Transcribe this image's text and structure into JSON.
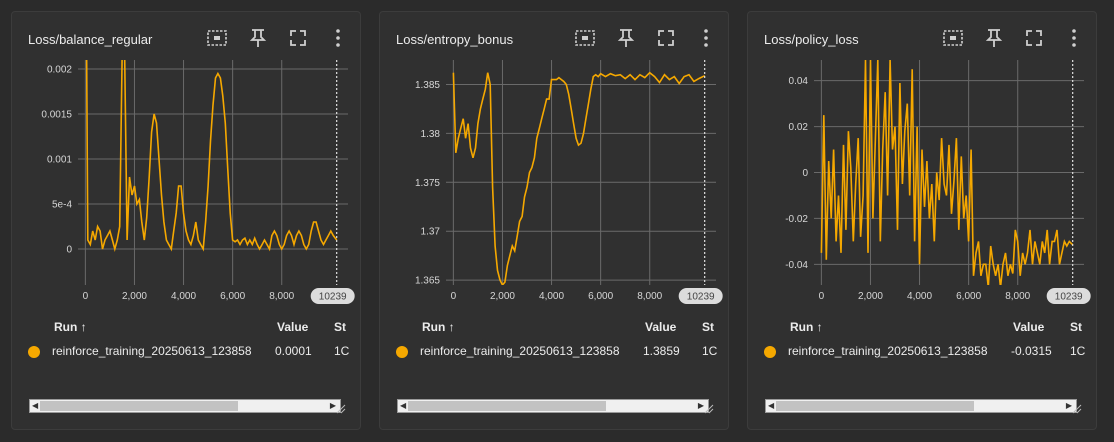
{
  "accent_color": "#f5a800",
  "toolbar_icons": [
    "fit-domain-icon",
    "pin-icon",
    "fullscreen-icon",
    "more-vert-icon"
  ],
  "table_headers": {
    "run": "Run ↑",
    "value": "Value",
    "step": "St"
  },
  "run_name": "reinforce_training_20250613_123858",
  "step_cell": "1C",
  "x_ticks": [
    "0",
    "2,000",
    "4,000",
    "6,000",
    "8,000"
  ],
  "hover_step": "10239",
  "chart_data": [
    {
      "type": "line",
      "title": "Loss/balance_regular",
      "value_text": "0.0001",
      "xlim": [
        -300,
        10700
      ],
      "ylim": [
        -0.0004,
        0.0021
      ],
      "yticks": [
        0,
        0.0005,
        0.001,
        0.0015,
        0.002
      ],
      "ytick_labels": [
        "0",
        "5e-4",
        "0.001",
        "0.0015",
        "0.002"
      ],
      "x": [
        0,
        50,
        100,
        200,
        300,
        400,
        500,
        600,
        700,
        800,
        900,
        1000,
        1100,
        1200,
        1300,
        1400,
        1500,
        1600,
        1700,
        1800,
        1900,
        2000,
        2100,
        2200,
        2300,
        2400,
        2500,
        2600,
        2700,
        2800,
        2900,
        3000,
        3100,
        3200,
        3300,
        3400,
        3500,
        3600,
        3700,
        3800,
        3900,
        4000,
        4100,
        4200,
        4300,
        4400,
        4500,
        4600,
        4700,
        4800,
        4900,
        5000,
        5100,
        5200,
        5300,
        5400,
        5500,
        5600,
        5700,
        5800,
        5900,
        6000,
        6100,
        6200,
        6300,
        6400,
        6500,
        6600,
        6700,
        6800,
        6900,
        7000,
        7100,
        7200,
        7300,
        7400,
        7500,
        7600,
        7700,
        7800,
        7900,
        8000,
        8100,
        8200,
        8300,
        8400,
        8500,
        8600,
        8700,
        8800,
        8900,
        9000,
        9100,
        9200,
        9300,
        9400,
        9500,
        9600,
        9700,
        9800,
        9900,
        10000,
        10100,
        10239
      ],
      "series": [
        {
          "values": [
            0.0022,
            0.0022,
            0.0001,
            5e-05,
            0.0002,
            0.0001,
            0.00025,
            0.0002,
            0.0,
            0.0001,
            0.00015,
            0.0002,
            0.0001,
            0.0,
            0.0001,
            0.00025,
            0.0022,
            0.0022,
            0.0001,
            0.0008,
            0.0006,
            0.0007,
            0.0005,
            0.00055,
            0.0003,
            0.0001,
            0.00035,
            0.0008,
            0.0013,
            0.0015,
            0.0014,
            0.001,
            0.0006,
            0.0003,
            0.0001,
            5e-05,
            0.0,
            0.0002,
            0.0004,
            0.0007,
            0.0007,
            0.0004,
            0.0002,
            0.0001,
            5e-05,
            0.00015,
            0.0003,
            0.0001,
            5e-05,
            0.0,
            0.0003,
            0.0007,
            0.0012,
            0.0016,
            0.0019,
            0.00195,
            0.0019,
            0.0017,
            0.0014,
            0.0009,
            0.0004,
            0.0001,
            8e-05,
            0.0001,
            5e-05,
            0.0001,
            0.00012,
            5e-05,
            0.0001,
            5e-05,
            0.00012,
            5e-05,
            0.0,
            5e-05,
            0.0001,
            5e-05,
            0.0,
            0.00015,
            0.0002,
            0.00015,
            5e-05,
            0.0,
            5e-05,
            0.00015,
            0.0002,
            0.00015,
            5e-05,
            0.00015,
            0.0002,
            0.00015,
            5e-05,
            0.0,
            5e-05,
            0.0002,
            0.0003,
            0.0003,
            0.0002,
            0.0001,
            5e-05,
            0.0001,
            0.00015,
            0.0002,
            0.00015,
            0.0001
          ]
        }
      ]
    },
    {
      "type": "line",
      "title": "Loss/entropy_bonus",
      "value_text": "1.3859",
      "xlim": [
        -300,
        10700
      ],
      "ylim": [
        1.3645,
        1.3875
      ],
      "yticks": [
        1.365,
        1.37,
        1.375,
        1.38,
        1.385
      ],
      "ytick_labels": [
        "1.365",
        "1.37",
        "1.375",
        "1.38",
        "1.385"
      ],
      "x": [
        0,
        100,
        200,
        300,
        400,
        500,
        600,
        700,
        800,
        900,
        1000,
        1100,
        1200,
        1300,
        1400,
        1500,
        1600,
        1700,
        1800,
        1900,
        2000,
        2100,
        2200,
        2300,
        2400,
        2500,
        2600,
        2700,
        2800,
        2900,
        3000,
        3100,
        3200,
        3300,
        3400,
        3500,
        3600,
        3700,
        3800,
        3900,
        4000,
        4100,
        4200,
        4300,
        4400,
        4500,
        4600,
        4700,
        4800,
        4900,
        5000,
        5100,
        5200,
        5300,
        5400,
        5500,
        5600,
        5700,
        5800,
        5900,
        6000,
        6200,
        6400,
        6600,
        6800,
        7000,
        7200,
        7400,
        7600,
        7800,
        8000,
        8200,
        8400,
        8600,
        8800,
        9000,
        9200,
        9400,
        9600,
        9800,
        10000,
        10239
      ],
      "series": [
        {
          "values": [
            1.3862,
            1.378,
            1.3795,
            1.3805,
            1.3815,
            1.3795,
            1.381,
            1.3785,
            1.3775,
            1.3785,
            1.381,
            1.3825,
            1.3835,
            1.3845,
            1.3862,
            1.385,
            1.3745,
            1.3685,
            1.366,
            1.365,
            1.3645,
            1.3648,
            1.3665,
            1.3675,
            1.3685,
            1.368,
            1.3695,
            1.371,
            1.3715,
            1.3735,
            1.3745,
            1.376,
            1.3765,
            1.3775,
            1.3795,
            1.3805,
            1.3815,
            1.3825,
            1.3835,
            1.3835,
            1.3855,
            1.3855,
            1.3855,
            1.3857,
            1.3855,
            1.3853,
            1.385,
            1.384,
            1.3825,
            1.381,
            1.3795,
            1.3788,
            1.379,
            1.38,
            1.3815,
            1.383,
            1.3845,
            1.3858,
            1.386,
            1.3858,
            1.3861,
            1.3858,
            1.3861,
            1.3859,
            1.386,
            1.3856,
            1.386,
            1.3855,
            1.386,
            1.3857,
            1.3862,
            1.3858,
            1.3852,
            1.386,
            1.3855,
            1.3858,
            1.3851,
            1.3858,
            1.386,
            1.3853,
            1.3856,
            1.3859
          ]
        }
      ]
    },
    {
      "type": "line",
      "title": "Loss/policy_loss",
      "value_text": "-0.0315",
      "xlim": [
        -300,
        10700
      ],
      "ylim": [
        -0.049,
        0.049
      ],
      "yticks": [
        -0.04,
        -0.02,
        0,
        0.02,
        0.04
      ],
      "ytick_labels": [
        "-0.04",
        "-0.02",
        "0",
        "0.02",
        "0.04"
      ],
      "x": [
        0,
        100,
        200,
        300,
        400,
        500,
        600,
        700,
        800,
        900,
        1000,
        1100,
        1200,
        1300,
        1400,
        1500,
        1600,
        1700,
        1800,
        1900,
        2000,
        2100,
        2200,
        2300,
        2400,
        2500,
        2600,
        2700,
        2800,
        2900,
        3000,
        3100,
        3200,
        3300,
        3400,
        3500,
        3600,
        3700,
        3800,
        3900,
        4000,
        4100,
        4200,
        4300,
        4400,
        4500,
        4600,
        4700,
        4800,
        4900,
        5000,
        5100,
        5200,
        5300,
        5400,
        5500,
        5600,
        5700,
        5800,
        5900,
        6000,
        6100,
        6200,
        6300,
        6400,
        6500,
        6600,
        6700,
        6800,
        6900,
        7000,
        7100,
        7200,
        7300,
        7400,
        7500,
        7600,
        7700,
        7800,
        7900,
        8000,
        8100,
        8200,
        8300,
        8400,
        8500,
        8600,
        8700,
        8800,
        8900,
        9000,
        9100,
        9200,
        9300,
        9400,
        9500,
        9600,
        9700,
        9800,
        9900,
        10000,
        10100,
        10239
      ],
      "series": [
        {
          "values": [
            -0.035,
            0.025,
            -0.038,
            0.005,
            -0.02,
            0.01,
            -0.03,
            -0.01,
            -0.035,
            0.012,
            -0.025,
            0.018,
            0.002,
            -0.03,
            -0.005,
            0.015,
            -0.028,
            -0.01,
            0.049,
            -0.035,
            0.049,
            -0.02,
            0.015,
            0.049,
            -0.03,
            0.01,
            0.035,
            -0.01,
            0.049,
            0.01,
            0.02,
            -0.025,
            0.039,
            -0.005,
            0.018,
            0.03,
            -0.01,
            0.045,
            -0.03,
            0.02,
            -0.04,
            0.01,
            -0.015,
            0.005,
            -0.02,
            -0.005,
            -0.03,
            0.0,
            -0.012,
            0.015,
            -0.005,
            -0.01,
            0.012,
            -0.018,
            -0.004,
            0.015,
            -0.025,
            0.007,
            -0.02,
            -0.01,
            -0.03,
            0.01,
            -0.045,
            -0.035,
            -0.03,
            -0.045,
            -0.04,
            -0.04,
            -0.05,
            -0.032,
            -0.04,
            -0.045,
            -0.04,
            -0.05,
            -0.04,
            -0.035,
            -0.045,
            -0.04,
            -0.044,
            -0.025,
            -0.03,
            -0.045,
            -0.035,
            -0.04,
            -0.035,
            -0.025,
            -0.04,
            -0.03,
            -0.035,
            -0.04,
            -0.03,
            -0.035,
            -0.025,
            -0.04,
            -0.03,
            -0.03,
            -0.025,
            -0.04,
            -0.035,
            -0.03,
            -0.032,
            -0.03,
            -0.0315
          ]
        }
      ]
    }
  ]
}
